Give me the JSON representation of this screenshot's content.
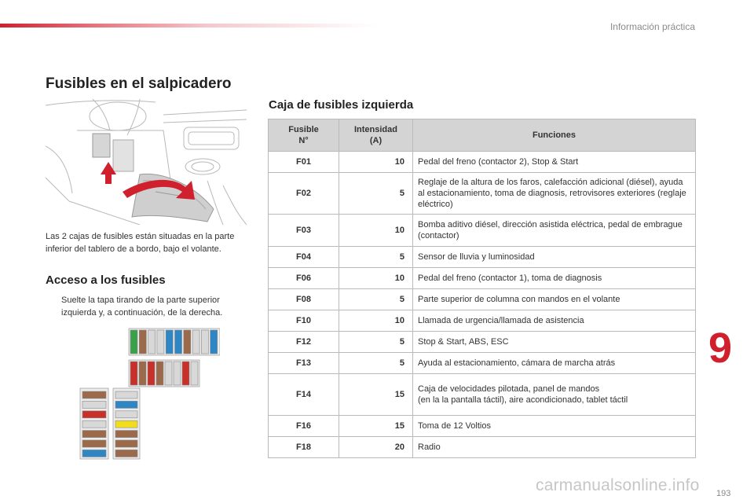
{
  "header": {
    "section": "Información práctica"
  },
  "title": "Fusibles en el salpicadero",
  "intro": "Las 2 cajas de fusibles están situadas en la parte inferior del tablero de a bordo, bajo el volante.",
  "access": {
    "title": "Acceso a los fusibles",
    "bullet": "",
    "step": "Suelte la tapa tirando de la parte superior izquierda y, a continuación, de la derecha."
  },
  "table": {
    "title": "Caja de fusibles izquierda",
    "headers": {
      "fuse_line1": "Fusible",
      "fuse_line2": "N°",
      "amp_line1": "Intensidad",
      "amp_line2": "(A)",
      "functions": "Funciones"
    },
    "rows": [
      {
        "fuse": "F01",
        "amps": "10",
        "function": "Pedal del freno (contactor 2), Stop & Start"
      },
      {
        "fuse": "F02",
        "amps": "5",
        "function": "Reglaje de la altura de los faros, calefacción adicional (diésel), ayuda al estacionamiento, toma de diagnosis, retrovisores exteriores (reglaje eléctrico)"
      },
      {
        "fuse": "F03",
        "amps": "10",
        "function": "Bomba aditivo diésel, dirección asistida eléctrica, pedal de embrague (contactor)"
      },
      {
        "fuse": "F04",
        "amps": "5",
        "function": "Sensor de lluvia y luminosidad"
      },
      {
        "fuse": "F06",
        "amps": "10",
        "function": "Pedal del freno (contactor 1), toma de diagnosis"
      },
      {
        "fuse": "F08",
        "amps": "5",
        "function": "Parte superior de columna con mandos en el volante"
      },
      {
        "fuse": "F10",
        "amps": "10",
        "function": "Llamada de urgencia/llamada de asistencia"
      },
      {
        "fuse": "F12",
        "amps": "5",
        "function": "Stop & Start, ABS, ESC"
      },
      {
        "fuse": "F13",
        "amps": "5",
        "function": "Ayuda al estacionamiento, cámara de marcha atrás"
      },
      {
        "fuse": "F14",
        "amps": "15",
        "function_line1": "Caja de velocidades pilotada, panel de mandos",
        "function_line2": "(en la la pantalla táctil), aire acondicionado, tablet táctil"
      },
      {
        "fuse": "F16",
        "amps": "15",
        "function": "Toma de 12 Voltios"
      },
      {
        "fuse": "F18",
        "amps": "20",
        "function": "Radio"
      }
    ]
  },
  "chapter": "9",
  "page_number": "193",
  "watermark": "carmanualsonline.info",
  "fusebox": {
    "colors": {
      "red": "#c8302a",
      "brown": "#9a6a4a",
      "blue": "#2f86c4",
      "green": "#3aa04a",
      "yellow": "#f2dc1e",
      "grey": "#d8d8d8",
      "white": "#f4f4f4"
    }
  },
  "colors": {
    "accent": "#d0202e",
    "table_header": "#d4d4d4",
    "border": "#b9b9b9"
  }
}
